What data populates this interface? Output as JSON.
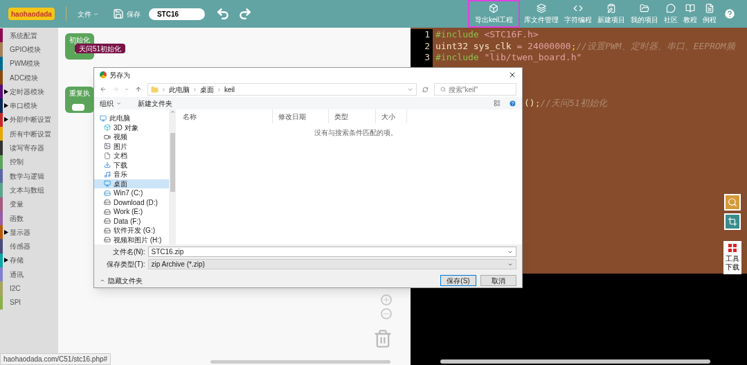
{
  "header": {
    "logo": "haohaodada",
    "file_menu": "文件",
    "save": "保存",
    "project_name": "STC16",
    "tools": [
      {
        "kind": "box",
        "label": "导出keil工程",
        "selected": true
      },
      {
        "kind": "layers",
        "label": "库文件管理",
        "selected": false
      },
      {
        "kind": "code",
        "label": "字符编程",
        "selected": false
      },
      {
        "kind": "clipboard",
        "label": "新建项目",
        "selected": false
      },
      {
        "kind": "folder",
        "label": "我的项目",
        "selected": false
      },
      {
        "kind": "chat",
        "label": "社区",
        "selected": false
      },
      {
        "kind": "book",
        "label": "教程",
        "selected": false
      },
      {
        "kind": "doc",
        "label": "例程",
        "selected": false
      }
    ]
  },
  "sidebar": {
    "items": [
      {
        "label": "系统配置",
        "color": "#8e0b4f",
        "expandable": false
      },
      {
        "label": "GPIO模块",
        "color": "#a57f56",
        "expandable": false
      },
      {
        "label": "PWM模块",
        "color": "#006a8e",
        "expandable": false
      },
      {
        "label": "ADC模块",
        "color": "#8b4a0b",
        "expandable": false
      },
      {
        "label": "定时器模块",
        "color": "#5a0a7a",
        "expandable": true
      },
      {
        "label": "串口模块",
        "color": "#0a2a5a",
        "expandable": true
      },
      {
        "label": "外部中断设置",
        "color": "#c62828",
        "expandable": true
      },
      {
        "label": "所有中断设置",
        "color": "#e6a800",
        "expandable": false
      },
      {
        "label": "读写寄存器",
        "color": "#333333",
        "expandable": false
      },
      {
        "label": "控制",
        "color": "#5ba55b",
        "expandable": false
      },
      {
        "label": "数学与逻辑",
        "color": "#5b67a5",
        "expandable": false
      },
      {
        "label": "文本与数组",
        "color": "#5ba58c",
        "expandable": false
      },
      {
        "label": "变量",
        "color": "#a55b80",
        "expandable": false
      },
      {
        "label": "函数",
        "color": "#995ba5",
        "expandable": false
      },
      {
        "label": "显示器",
        "color": "#b85c0a",
        "expandable": true
      },
      {
        "label": "传感器",
        "color": "#4a4a7a",
        "expandable": false
      },
      {
        "label": "存储",
        "color": "#0aa5a5",
        "expandable": true
      },
      {
        "label": "通讯",
        "color": "#8080d0",
        "expandable": false
      },
      {
        "label": "I2C",
        "color": "#a5a55b",
        "expandable": false
      },
      {
        "label": "SPI",
        "color": "#8cb04a",
        "expandable": false
      }
    ]
  },
  "workspace": {
    "blocks": [
      {
        "label": "初始化",
        "inner": "天问51初始化"
      },
      {
        "label": "重复执"
      }
    ]
  },
  "editor": {
    "lines": [
      {
        "number": "1",
        "tokens": [
          {
            "kind": "keyword",
            "text": "#include "
          },
          {
            "kind": "string",
            "text": "<STC16F.h>"
          }
        ]
      },
      {
        "number": "2",
        "tokens": [
          {
            "kind": "plain",
            "text": "uint32 sys_clk "
          },
          {
            "kind": "string",
            "text": "= 24000000"
          },
          {
            "kind": "punct",
            "text": ";"
          },
          {
            "kind": "comment",
            "text": "//设置PWM、定时器、串口、EEPROM频"
          }
        ]
      },
      {
        "number": "3",
        "tokens": [
          {
            "kind": "keyword",
            "text": "#include "
          },
          {
            "kind": "string",
            "text": "\"lib/twen_board.h\""
          }
        ]
      }
    ],
    "partial_line": {
      "tokens": [
        {
          "kind": "plain",
          "text": "()"
        },
        {
          "kind": "punct",
          "text": ";"
        },
        {
          "kind": "comment",
          "text": "//天问51初始化"
        }
      ]
    }
  },
  "dialog": {
    "title": "另存为",
    "path": [
      "此电脑",
      "桌面",
      "keil"
    ],
    "search_placeholder": "搜索\"keil\"",
    "organize": "组织",
    "new_folder": "新建文件夹",
    "tree": [
      {
        "kind": "pc",
        "label": "此电脑",
        "selected": false,
        "children": [
          {
            "kind": "cube",
            "label": "3D 对象",
            "selected": false
          },
          {
            "kind": "video",
            "label": "视频",
            "selected": false
          },
          {
            "kind": "picture",
            "label": "图片",
            "selected": false
          },
          {
            "kind": "document",
            "label": "文档",
            "selected": false
          },
          {
            "kind": "download",
            "label": "下载",
            "selected": false
          },
          {
            "kind": "music",
            "label": "音乐",
            "selected": false
          },
          {
            "kind": "desktop",
            "label": "桌面",
            "selected": true
          },
          {
            "kind": "system",
            "label": "Win7 (C:)",
            "selected": false
          },
          {
            "kind": "drive",
            "label": "Download (D:)",
            "selected": false
          },
          {
            "kind": "drive",
            "label": "Work (E:)",
            "selected": false
          },
          {
            "kind": "drive",
            "label": "Data (F:)",
            "selected": false
          },
          {
            "kind": "drive",
            "label": "软件开发 (G:)",
            "selected": false
          },
          {
            "kind": "drive",
            "label": "视频和图片 (H:)",
            "selected": false
          }
        ]
      }
    ],
    "columns": [
      "名称",
      "修改日期",
      "类型",
      "大小"
    ],
    "empty_message": "没有与搜索条件匹配的项。",
    "filename_label": "文件名(N):",
    "filename": "STC16.zip",
    "filetype_label": "保存类型(T):",
    "filetype": "zip Archive (*.zip)",
    "hide_folders": "隐藏文件夹",
    "buttons": [
      {
        "label": "保存(S)",
        "primary": true
      },
      {
        "label": "取消",
        "primary": false
      }
    ]
  },
  "tool_panel": {
    "download_label": "工具下载"
  },
  "status_bar": {
    "url": "haohaodada.com/C51/stc16.php#"
  }
}
